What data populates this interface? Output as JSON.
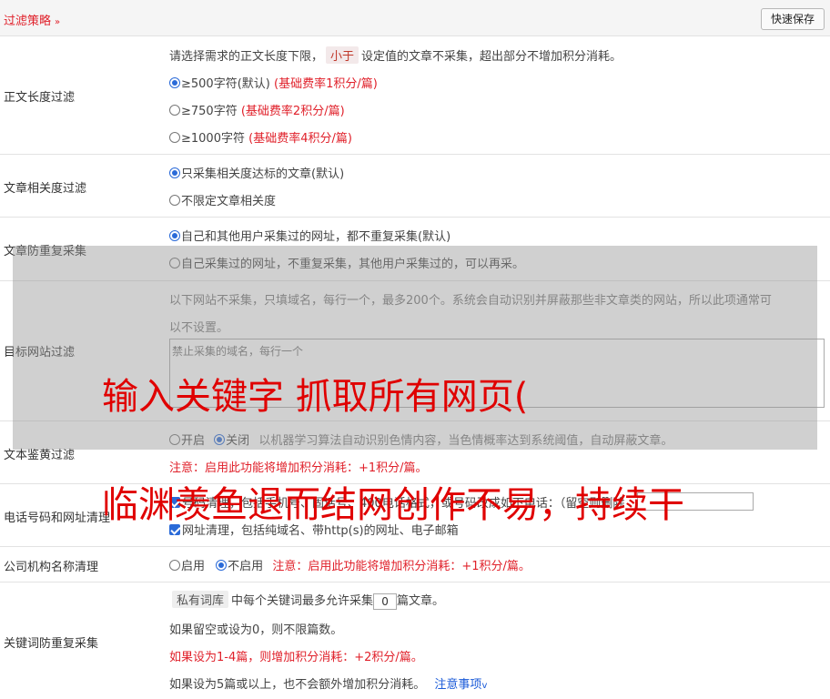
{
  "header": {
    "title": "过滤策略",
    "chevron": "»",
    "save_label": "快速保存"
  },
  "length_filter": {
    "label": "正文长度过滤",
    "desc_before": "请选择需求的正文长度下限，",
    "desc_tag": "小于",
    "desc_after": "设定值的文章不采集，超出部分不增加积分消耗。",
    "options": [
      {
        "label": "≥500字符(默认)",
        "note": "(基础费率1积分/篇)",
        "selected": true
      },
      {
        "label": "≥750字符",
        "note": "(基础费率2积分/篇)",
        "selected": false
      },
      {
        "label": "≥1000字符",
        "note": "(基础费率4积分/篇)",
        "selected": false
      }
    ]
  },
  "relevance_filter": {
    "label": "文章相关度过滤",
    "options": [
      {
        "label": "只采集相关度达标的文章(默认)",
        "selected": true
      },
      {
        "label": "不限定文章相关度",
        "selected": false
      }
    ]
  },
  "dedupe": {
    "label": "文章防重复采集",
    "options": [
      {
        "label": "自己和其他用户采集过的网址，都不重复采集(默认)",
        "selected": true
      },
      {
        "label": "自己采集过的网址，不重复采集，其他用户采集过的，可以再采。",
        "selected": false
      }
    ]
  },
  "site_filter": {
    "label": "目标网站过滤",
    "desc_line1": "以下网站不采集，只填域名，每行一个，最多200个。系统会自动识别并屏蔽那些非文章类的网站，所以此项通常可",
    "desc_line2": "以不设置。",
    "placeholder": "禁止采集的域名，每行一个"
  },
  "porn_filter": {
    "label": "文本鉴黄过滤",
    "option_on": "开启",
    "option_off": "关闭",
    "desc": "以机器学习算法自动识别色情内容，当色情概率达到系统阈值，自动屏蔽文章。",
    "note": "注意：启用此功能将增加积分消耗：+1积分/篇。"
  },
  "phone_clean": {
    "label": "电话号码和网址清理",
    "line1": "号码清理，包括手机号、固话号、400电话格式，或号码改成如下电话：（留空则删除",
    "line2": "网址清理，包括纯域名、带http(s)的网址、电子邮箱"
  },
  "org_clean": {
    "label": "公司机构名称清理",
    "option_on": "启用",
    "option_off": "不启用",
    "note": "注意：启用此功能将增加积分消耗：+1积分/篇。"
  },
  "keyword_dedupe": {
    "label": "关键词防重复采集",
    "tag": "私有词库",
    "line1_mid": "中每个关键词最多允许采集",
    "value": "0",
    "line1_end": "篇文章。",
    "line2": "如果留空或设为0，则不限篇数。",
    "line3": "如果设为1-4篇，则增加积分消耗：+2积分/篇。",
    "line4": "如果设为5篇或以上，也不会额外增加积分消耗。",
    "link": "注意事项",
    "link_chevron": "v"
  },
  "overlay": {
    "line1": "输入关键字 抓取所有网页(",
    "line2": "临渊羡鱼退而结网创作不易，持续干"
  },
  "colors": {
    "accent_red": "#e0202a",
    "radio_blue": "#2a6ad8",
    "link_blue": "#1a5ad8"
  }
}
